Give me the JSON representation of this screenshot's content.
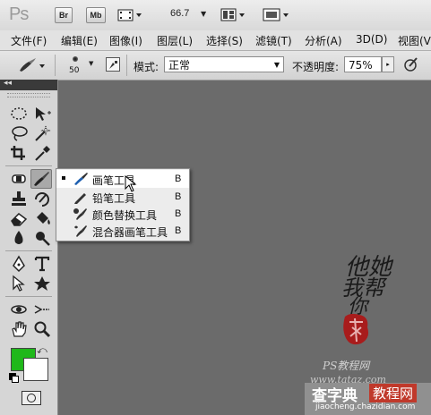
{
  "app_bar": {
    "logo": "Ps",
    "bridge_label": "Br",
    "minibridge_label": "Mb",
    "zoom": "66.7"
  },
  "menu": [
    "文件(F)",
    "编辑(E)",
    "图像(I)",
    "图层(L)",
    "选择(S)",
    "滤镜(T)",
    "分析(A)",
    "3D(D)",
    "视图(V"
  ],
  "options": {
    "brush_size": "50",
    "mode_label": "模式:",
    "mode_value": "正常",
    "opacity_label": "不透明度:",
    "opacity_value": "75%"
  },
  "toolbox": {
    "collapse_label": "◂◂"
  },
  "flyout": [
    {
      "label": "画笔工具",
      "key": "B",
      "selected": true
    },
    {
      "label": "铅笔工具",
      "key": "B",
      "selected": false
    },
    {
      "label": "颜色替换工具",
      "key": "B",
      "selected": false
    },
    {
      "label": "混合器画笔工具",
      "key": "B",
      "selected": false
    }
  ],
  "colors": {
    "foreground": "#1fb81a",
    "background": "#ffffff"
  },
  "watermark": {
    "calligraphy": [
      "他她",
      "我帮",
      "你"
    ],
    "ps_site": "PS教程网",
    "ps_url": "www.tataz.com",
    "site_name": "查字典",
    "site_tag": "教程网",
    "site_url": "jiaocheng.chazidian.com"
  }
}
